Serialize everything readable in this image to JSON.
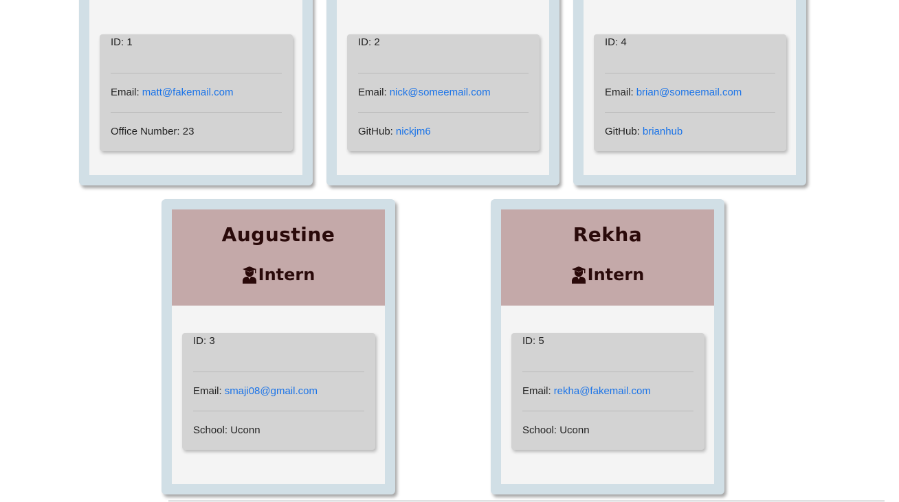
{
  "top_cards": [
    {
      "id_text": "ID: 1",
      "email_label": "Email:",
      "email": "matt@fakemail.com",
      "extra_label": "Office Number: 23",
      "extra_link": ""
    },
    {
      "id_text": "ID: 2",
      "email_label": "Email:",
      "email": "nick@someemail.com",
      "extra_label": "GitHub:",
      "extra_link": "nickjm6"
    },
    {
      "id_text": "ID: 4",
      "email_label": "Email:",
      "email": "brian@someemail.com",
      "extra_label": "GitHub:",
      "extra_link": "brianhub"
    }
  ],
  "bottom_cards": [
    {
      "name": "Augustine",
      "role": "Intern",
      "role_icon": "user-graduate-icon",
      "id_text": "ID: 3",
      "email_label": "Email:",
      "email": "smaji08@gmail.com",
      "extra_label": "School: Uconn"
    },
    {
      "name": "Rekha",
      "role": "Intern",
      "role_icon": "user-graduate-icon",
      "id_text": "ID: 5",
      "email_label": "Email:",
      "email": "rekha@fakemail.com",
      "extra_label": "School: Uconn"
    }
  ],
  "colors": {
    "card_frame": "#d1dfe6",
    "card_body": "#f4f4f4",
    "header_bg": "#c4a9a9",
    "header_text": "#2a0a0a",
    "info_bg": "#d3d3d3",
    "link": "#1a73e8"
  }
}
